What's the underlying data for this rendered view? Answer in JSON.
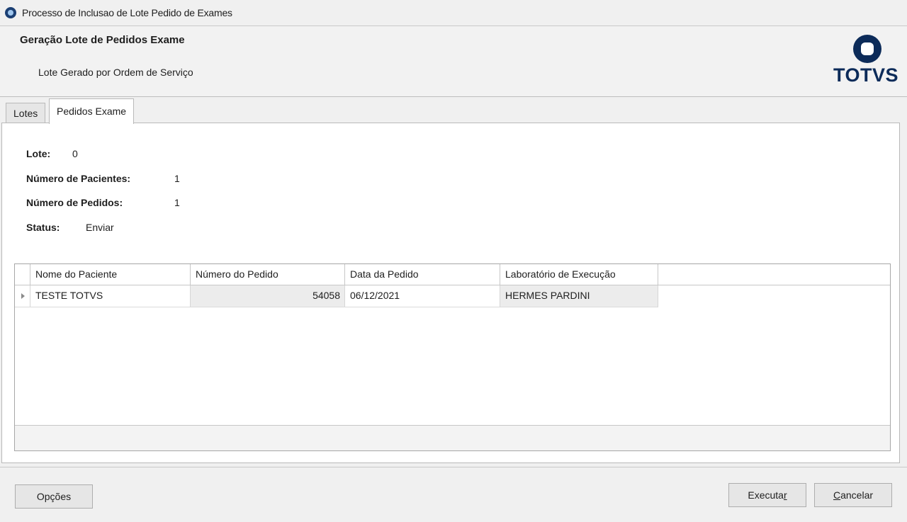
{
  "window": {
    "title": "Processo de Inclusao de Lote Pedido de Exames"
  },
  "header": {
    "title": "Geração Lote de Pedidos Exame",
    "subtitle": "Lote Gerado por Ordem de Serviço",
    "logo_text": "TOTVS",
    "brand_color": "#0c2b59"
  },
  "tabs": [
    {
      "label": "Lotes",
      "active": false
    },
    {
      "label": "Pedidos Exame",
      "active": true
    }
  ],
  "info": {
    "lote_label": "Lote:",
    "lote_value": "0",
    "pacientes_label": "Número de Pacientes:",
    "pacientes_value": "1",
    "pedidos_label": "Número de Pedidos:",
    "pedidos_value": "1",
    "status_label": "Status:",
    "status_value": "Enviar"
  },
  "grid": {
    "columns": [
      "Nome do Paciente",
      "Número do Pedido",
      "Data da Pedido",
      "Laboratório de Execução"
    ],
    "rows": [
      {
        "nome": "TESTE TOTVS",
        "numero": "54058",
        "data": "06/12/2021",
        "laboratorio": "HERMES PARDINI"
      }
    ]
  },
  "buttons": {
    "opcoes": "Opções",
    "executar_main": "Executa",
    "executar_hotkey": "r",
    "cancelar_hotkey": "C",
    "cancelar_main": "ancelar"
  }
}
